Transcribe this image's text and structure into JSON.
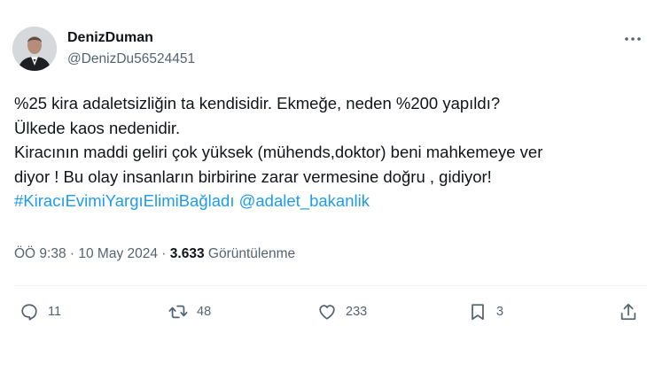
{
  "author": {
    "display_name": "DenizDuman",
    "handle": "@DenizDu56524451"
  },
  "tweet": {
    "lines": [
      "%25 kira adaletsizliğin ta kendisidir. Ekmeğe, neden %200 yapıldı?",
      "Ülkede kaos nedenidir.",
      "Kiracının maddi geliri çok yüksek (mühends,doktor) beni mahkemeye ver",
      "diyor ! Bu olay insanların birbirine zarar vermesine doğru , gidiyor!"
    ],
    "hashtag": "#KiracıEvimiYargıElimiBağladı",
    "mention": "@adalet_bakanlik"
  },
  "meta": {
    "time": "ÖÖ 9:38",
    "separator": " · ",
    "date": "10 May 2024",
    "views_count": "3.633",
    "views_label": "Görüntülenme"
  },
  "actions": {
    "replies": "11",
    "reposts": "48",
    "likes": "233",
    "bookmarks": "3"
  },
  "icons": {
    "more": "more-horizontal-icon",
    "reply": "reply-icon",
    "repost": "repost-icon",
    "like": "heart-icon",
    "bookmark": "bookmark-icon",
    "share": "share-icon"
  },
  "colors": {
    "link": "#1d9bf0",
    "secondary_text": "#536471",
    "primary_text": "#0f1419"
  }
}
